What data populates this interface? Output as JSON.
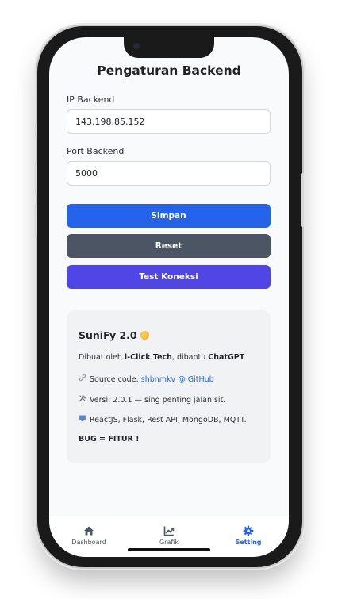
{
  "page": {
    "title": "Pengaturan Backend"
  },
  "form": {
    "ip_label": "IP Backend",
    "ip_value": "143.198.85.152",
    "port_label": "Port Backend",
    "port_value": "5000"
  },
  "buttons": {
    "save": "Simpan",
    "reset": "Reset",
    "test": "Test Koneksi"
  },
  "info": {
    "app_name": "SuniFy 2.0",
    "made_by_prefix": "Dibuat oleh ",
    "made_by": "i-Click Tech",
    "helped_prefix": ", dibantu ",
    "helped_by": "ChatGPT",
    "source_prefix": "Source code: ",
    "source_link": "shbnmkv @ GitHub",
    "version": "Versi: 2.0.1 — sing penting jalan sit.",
    "stack": "ReactJS, Flask, Rest API, MongoDB, MQTT.",
    "motto": "BUG = FITUR !"
  },
  "nav": [
    {
      "label": "Dashboard",
      "icon": "home-icon"
    },
    {
      "label": "Grafik",
      "icon": "chart-line-icon"
    },
    {
      "label": "Setting",
      "icon": "gear-icon"
    }
  ],
  "colors": {
    "primary": "#2563eb",
    "secondary": "#4b5563",
    "indigo": "#4f46e5"
  }
}
